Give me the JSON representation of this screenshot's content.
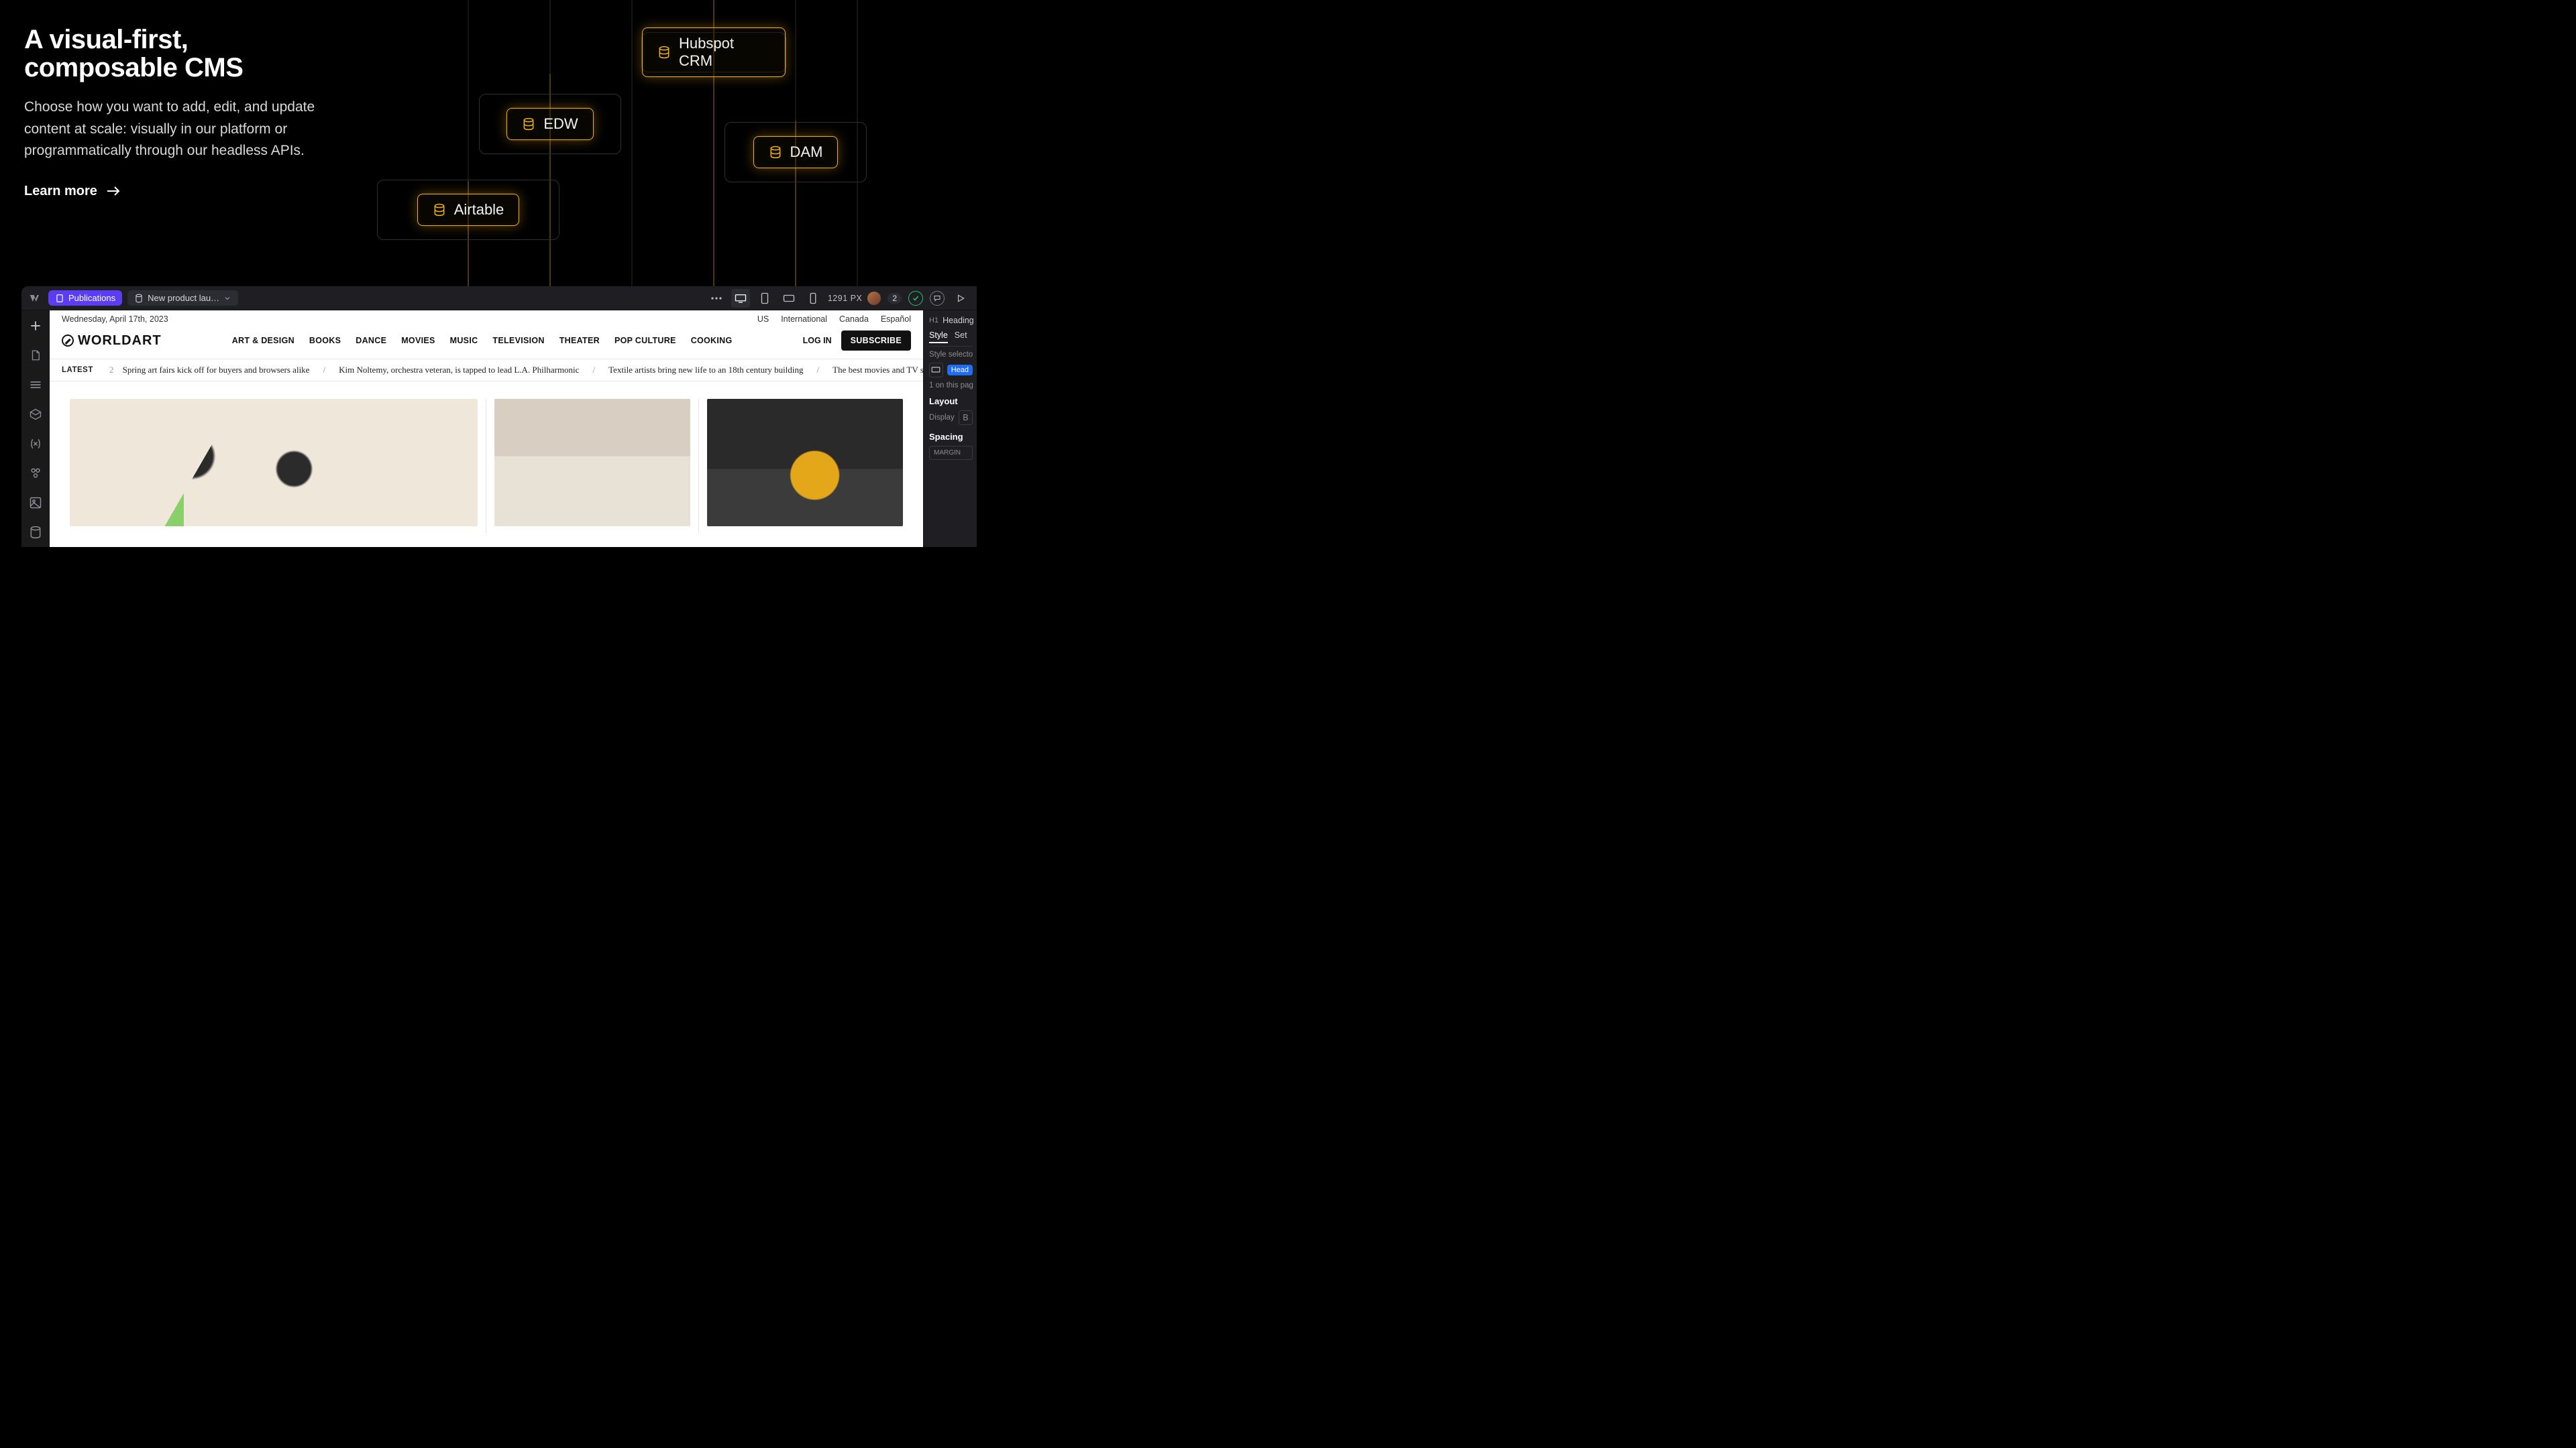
{
  "hero": {
    "title": "A visual-first,\ncomposable CMS",
    "subtitle": "Choose how you want to add, edit, and update content at scale: visually in our platform or programmatically through our headless APIs.",
    "cta": "Learn more"
  },
  "integrations": {
    "hubspot": "Hubspot CRM",
    "edw": "EDW",
    "dam": "DAM",
    "airtable": "Airtable"
  },
  "designer": {
    "topbar": {
      "publications": "Publications",
      "collection": "New product lau…",
      "breakpoint": "1291 PX",
      "collab_count": "2"
    },
    "style_panel": {
      "element_tag": "H1",
      "element_label": "Heading",
      "tab_style": "Style",
      "tab_settings": "Set",
      "selector_label": "Style selecto",
      "selector_value": "Head",
      "count_text": "1 on this pag",
      "section_layout": "Layout",
      "display_label": "Display",
      "display_value": "B",
      "section_spacing": "Spacing",
      "margin_label": "MARGIN"
    }
  },
  "site": {
    "date": "Wednesday, April 17th, 2023",
    "locales": [
      "US",
      "International",
      "Canada",
      "Español"
    ],
    "brand": "WORLDART",
    "nav": [
      "ART & DESIGN",
      "BOOKS",
      "DANCE",
      "MOVIES",
      "MUSIC",
      "TELEVISION",
      "THEATER",
      "POP CULTURE",
      "COOKING"
    ],
    "login": "LOG IN",
    "subscribe": "SUBSCRIBE",
    "ticker_label": "LATEST",
    "ticker": [
      "Spring art fairs kick off for buyers and browsers alike",
      "Kim Noltemy, orchestra veteran, is tapped to lead L.A. Philharmonic",
      "Textile artists bring new life to an 18th century building",
      "The best movies and TV shows coming"
    ]
  }
}
